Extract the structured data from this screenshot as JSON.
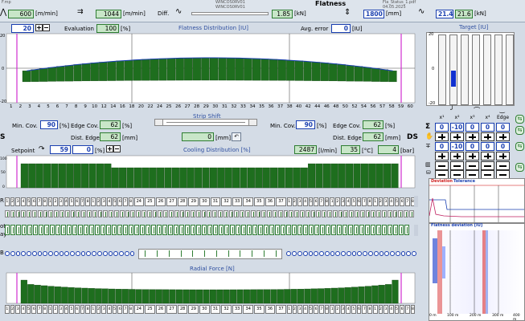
{
  "header": {
    "title": "Flatness",
    "file_left": "F.mp",
    "file_mid1": "WINCOS0RV01",
    "file_mid2": "WINCOS0RV01",
    "file_right1": "Fla_Status_1.pdf",
    "file_right2": "04.05.2025",
    "speed1": "600",
    "speed1_unit": "[m/min]",
    "speed2": "1044",
    "speed2_unit": "[m/min]",
    "diff_label": "Diff.",
    "force": "1.85",
    "force_unit": "[kN]",
    "width": "1800",
    "width_unit": "[mm]",
    "t1": "21.4",
    "t2": "21.6",
    "t_unit": "[kN]"
  },
  "flatness": {
    "sigma_value": "20",
    "evaluation_label": "Evaluation",
    "evaluation": "100",
    "evaluation_unit": "[%]",
    "title": "Flatness Distribution [IU]",
    "avg_error_label": "Avg. error",
    "avg_error": "0",
    "avg_error_unit": "[IU]",
    "y_ticks": [
      "20",
      "0",
      "-20"
    ],
    "zone_labels": [
      "1",
      "2",
      "3",
      "4",
      "5",
      "6",
      "7",
      "8",
      "9",
      "10",
      "12",
      "14",
      "16",
      "18",
      "20",
      "22",
      "24",
      "25",
      "26",
      "27",
      "28",
      "29",
      "30",
      "31",
      "32",
      "33",
      "34",
      "35",
      "36",
      "37",
      "38",
      "40",
      "42",
      "44",
      "46",
      "48",
      "50",
      "52",
      "54",
      "56",
      "57",
      "58",
      "59",
      "60"
    ]
  },
  "target": {
    "title": "Target [IU]",
    "y_ticks": [
      "20",
      "0",
      "-20"
    ],
    "x_labels": [
      "x¹",
      "x²",
      "x³",
      "x⁴",
      "Edge"
    ],
    "row1": [
      "0",
      "-10",
      "0",
      "0",
      "0"
    ],
    "row2": [
      "0",
      "-10",
      "0",
      "0",
      "0"
    ],
    "sigma": "Σ"
  },
  "strip": {
    "min_cov_label": "Min. Cov.",
    "min_cov_left": "90",
    "min_cov_unit": "[%]",
    "edge_cov_label": "Edge Cov.",
    "edge_cov_left": "62",
    "edge_cov_unit": "[%]",
    "dist_edge_label": "Dist. Edge",
    "dist_edge_left": "62",
    "dist_edge_unit": "[mm]",
    "shift_label": "Strip Shift",
    "shift_value": "0",
    "shift_unit": "[mm]",
    "min_cov_right": "90",
    "edge_cov_right": "62",
    "dist_edge_right": "62",
    "ds_label": "DS",
    "os_label": "S"
  },
  "cooling": {
    "setpoint_label": "Setpoint",
    "setpoint": "59",
    "setpoint2": "0",
    "setpoint_unit": "[%]",
    "title": "Cooling Distribution [%]",
    "flow": "2487",
    "flow_unit": "[l/min]",
    "temp": "35",
    "temp_unit": "[°C]",
    "pressure": "4",
    "pressure_unit": "[bar]",
    "y_ticks": [
      "100",
      "50",
      "0"
    ],
    "row1_label": "R",
    "row2_label": "ot",
    "row2b_label": "ay",
    "row3_label": "B",
    "mid_labels": [
      "24",
      "25",
      "26",
      "27",
      "28",
      "29",
      "30",
      "31",
      "32",
      "33",
      "34",
      "35",
      "36",
      "37"
    ]
  },
  "radial": {
    "title": "Radial Force [N]",
    "end_labels": [
      "1",
      "2",
      "3",
      "4",
      "5",
      "6",
      "7",
      "8"
    ]
  },
  "trend": {
    "deviation_label": "Deviation",
    "tolerance_label": "Tolerance",
    "flatness_dev_title": "Flatness deviation [IU]",
    "x_ticks": [
      "0 m",
      "100 m",
      "200 m",
      "300 m",
      "400 m"
    ]
  }
}
